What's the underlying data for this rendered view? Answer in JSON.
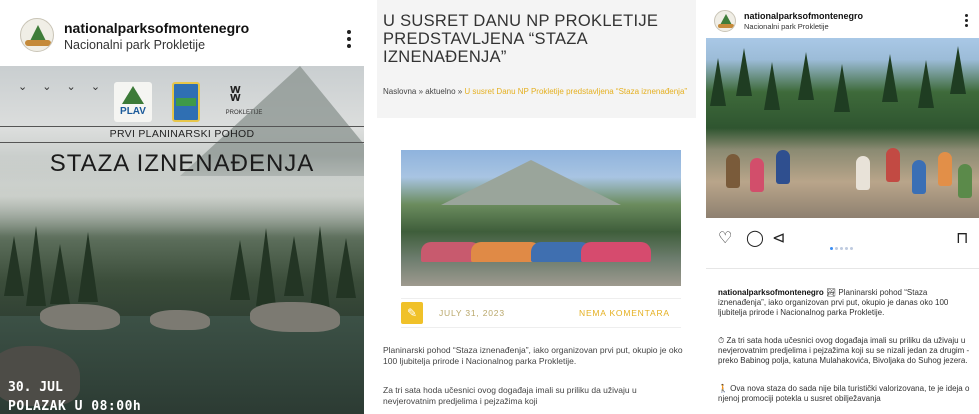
{
  "panel1": {
    "account_name": "nationalparksofmontenegro",
    "account_subtitle": "Nacionalni park Prokletije",
    "poster": {
      "logo_plav": "PLAV",
      "logo_np": "PROKLETIJE",
      "kicker": "PRVI PLANINARSKI POHOD",
      "title": "STAZA IZNENAĐENJA",
      "date": "30. JUL",
      "departure": "POLAZAK U 08:00h"
    }
  },
  "panel2": {
    "title": "U SUSRET DANU NP PROKLETIJE PREDSTAVLJENA “STAZA IZNENAĐENJA”",
    "breadcrumb": {
      "home": "Naslovna",
      "sep1": " » ",
      "section": "aktuelno",
      "sep2": " » ",
      "current": "U susret Danu NP Prokletije predstavljena “Staza iznenađenja”"
    },
    "meta": {
      "date": "JULY 31, 2023",
      "comments": "NEMA KOMENTARA"
    },
    "body": [
      "Planinarski pohod “Staza iznenađenja”, iako organizovan prvi put, okupio je oko 100 ljubitelja prirode i Nacionalnog parka Prokletije.",
      "Za tri sata hoda učesnici ovog događaja imali su priliku da uživaju u nevjerovatnim predjelima i pejzažima koji"
    ]
  },
  "panel3": {
    "account_name": "nationalparksofmontenegro",
    "account_subtitle": "Nacionalni park Prokletije",
    "caption": {
      "username": "nationalparksofmontenegro",
      "p1": " 🏞 Planinarski pohod “Staza iznenađenja”, iako organizovan prvi put, okupio je danas oko 100 ljubitelja prirode i Nacionalnog parka Prokletije.",
      "p2": "⏱ Za tri sata hoda učesnici ovog događaja imali su priliku da uživaju u nevjerovatnim predjelima i pejzažima koji su se nizali jedan za drugim - preko Babinog polja, katuna Mulahakovića, Bivoljaka do Suhog jezera.",
      "p3": "🚶 Ova nova staza do sada nije bila turistički valorizovana, te je ideja o njenoj promociji potekla u susret obilježavanja"
    }
  },
  "icons": {
    "more": "more-vertical-icon",
    "like": "heart-outline-icon",
    "comment": "comment-outline-icon",
    "share": "send-icon",
    "save": "bookmark-outline-icon",
    "edit": "pencil-icon"
  },
  "colors": {
    "accent_yellow": "#e5b021",
    "pager_active": "#3b8ef5",
    "np_green": "#3f7d3a"
  }
}
